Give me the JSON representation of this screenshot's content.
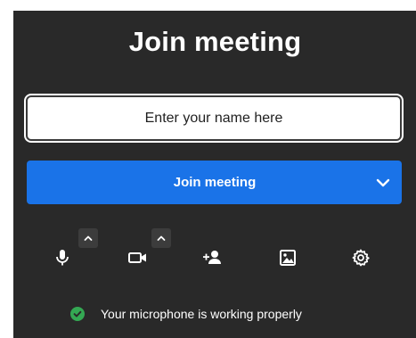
{
  "title": "Join meeting",
  "name_input": {
    "placeholder": "Enter your name here",
    "value": ""
  },
  "join_button": {
    "label": "Join meeting"
  },
  "toolbar": [
    {
      "icon": "microphone-icon",
      "has_options": true
    },
    {
      "icon": "camera-icon",
      "has_options": true
    },
    {
      "icon": "invite-people-icon",
      "has_options": false
    },
    {
      "icon": "background-image-icon",
      "has_options": false
    },
    {
      "icon": "settings-gear-icon",
      "has_options": false
    }
  ],
  "status": {
    "icon": "check-circle-icon",
    "text": "Your microphone is working properly",
    "color": "#34a853"
  },
  "colors": {
    "panel": "#292929",
    "accent": "#1a73e8"
  }
}
